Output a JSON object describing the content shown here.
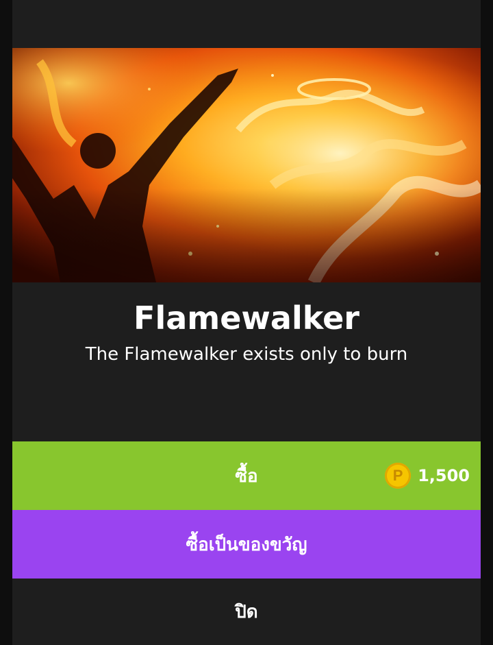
{
  "item": {
    "name": "Flamewalker",
    "description": "The Flamewalker exists only to burn"
  },
  "actions": {
    "buy_label": "ซื้อ",
    "gift_label": "ซื้อเป็นของขวัญ",
    "close_label": "ปิด"
  },
  "price": {
    "currency_symbol": "P",
    "amount": "1,500"
  },
  "colors": {
    "buy_button": "#88c62e",
    "gift_button": "#9a44f0",
    "modal_background": "#1e1e1e",
    "coin": "#f6c500"
  },
  "icons": {
    "currency": "coin-icon"
  }
}
